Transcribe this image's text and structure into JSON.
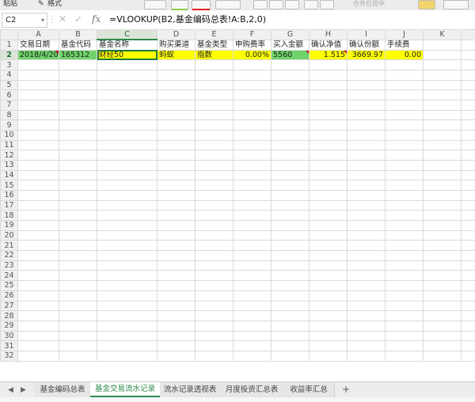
{
  "toolbar": {
    "paste_label": "粘贴",
    "format_label": "格式",
    "merge_label": "合并后居中"
  },
  "formula_bar": {
    "name_box": "C2",
    "formula": "=VLOOKUP(B2,基金编码总表!A:B,2,0)"
  },
  "columns": [
    "A",
    "B",
    "C",
    "D",
    "E",
    "F",
    "G",
    "H",
    "I",
    "J",
    "K"
  ],
  "row_numbers": [
    "1",
    "2",
    "3",
    "4",
    "5",
    "6",
    "7",
    "8",
    "9",
    "10",
    "11",
    "12",
    "13",
    "14",
    "15",
    "16",
    "17",
    "18",
    "19",
    "20",
    "21",
    "22",
    "23",
    "24",
    "25",
    "26",
    "27",
    "28",
    "29",
    "30",
    "31",
    "32"
  ],
  "header_row": [
    "交易日期",
    "基金代码",
    "基金名称",
    "购买渠道",
    "基金类型",
    "申购费率",
    "买入金额",
    "确认净值",
    "确认份额",
    "手续费"
  ],
  "data_row": [
    "2018/4/20",
    "165312",
    "财经50",
    "蚂蚁",
    "指数",
    "0.00%",
    "5560",
    "1.515",
    "3669.97",
    "0.00"
  ],
  "sheet_tabs": [
    "基金编码总表",
    "基金交易流水记录",
    "流水记录透视表",
    "月度投资汇总表",
    "收益率汇总"
  ],
  "colors": {
    "green_fill": "#6fd36a",
    "yellow_fill": "#ffff00",
    "accent": "#2d8a4a"
  }
}
